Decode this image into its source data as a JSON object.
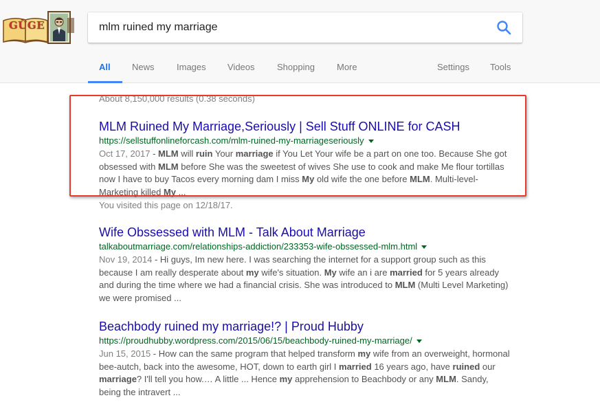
{
  "logo": {
    "text": "GŬGE",
    "icon": "doodle-book-portrait-icon"
  },
  "search": {
    "query": "mlm ruined my marriage",
    "icon": "search-icon"
  },
  "tabs": [
    {
      "label": "All",
      "active": true
    },
    {
      "label": "News"
    },
    {
      "label": "Images"
    },
    {
      "label": "Videos"
    },
    {
      "label": "Shopping"
    },
    {
      "label": "More"
    },
    {
      "label": "Settings"
    },
    {
      "label": "Tools"
    }
  ],
  "stats": "About 8,150,000 results (0.38 seconds)",
  "results": [
    {
      "title": "MLM Ruined My Marriage,Seriously | Sell Stuff ONLINE for CASH",
      "url": "https://sellstuffonlineforcash.com/mlm-ruined-my-marriageseriously",
      "date": "Oct 17, 2017",
      "snippet": [
        {
          "t": " - "
        },
        {
          "t": "MLM",
          "b": true
        },
        {
          "t": " will "
        },
        {
          "t": "ruin",
          "b": true
        },
        {
          "t": " Your "
        },
        {
          "t": "marriage",
          "b": true
        },
        {
          "t": " if You Let Your wife be a part on one too. Because She got obsessed with "
        },
        {
          "t": "MLM",
          "b": true
        },
        {
          "t": " before She was the sweetest of wives She use to cook and make Me flour tortillas now I have to buy Tacos every morning dam I miss "
        },
        {
          "t": "My",
          "b": true
        },
        {
          "t": " old wife the one before "
        },
        {
          "t": "MLM",
          "b": true
        },
        {
          "t": ". Multi-level-Marketing killed "
        },
        {
          "t": "My",
          "b": true
        },
        {
          "t": " ..."
        }
      ],
      "visited": "You visited this page on 12/18/17."
    },
    {
      "title": "Wife Obssessed with MLM - Talk About Marriage",
      "url": "talkaboutmarriage.com/relationships-addiction/233353-wife-obssessed-mlm.html",
      "date": "Nov 19, 2014",
      "snippet": [
        {
          "t": " - Hi guys, Im new here. I was searching the internet for a support group such as this because I am really desperate about "
        },
        {
          "t": "my",
          "b": true
        },
        {
          "t": " wife's situation. "
        },
        {
          "t": "My",
          "b": true
        },
        {
          "t": " wife an i are "
        },
        {
          "t": "married",
          "b": true
        },
        {
          "t": " for 5 years already and during the time where we had a financial crisis. She was introduced to "
        },
        {
          "t": "MLM",
          "b": true
        },
        {
          "t": " (Multi Level Marketing) we were promised ..."
        }
      ]
    },
    {
      "title": "Beachbody ruined my marriage!? | Proud Hubby",
      "url": "https://proudhubby.wordpress.com/2015/06/15/beachbody-ruined-my-marriage/",
      "date": "Jun 15, 2015",
      "snippet": [
        {
          "t": " - How can the same program that helped transform "
        },
        {
          "t": "my",
          "b": true
        },
        {
          "t": " wife from an overweight, hormonal bee-autch, back into the awesome, HOT, down to earth girl I "
        },
        {
          "t": "married",
          "b": true
        },
        {
          "t": " 16 years ago, have "
        },
        {
          "t": "ruined",
          "b": true
        },
        {
          "t": " our "
        },
        {
          "t": "marriage",
          "b": true
        },
        {
          "t": "? I'll tell you how.… A little ... Hence "
        },
        {
          "t": "my",
          "b": true
        },
        {
          "t": " apprehension to Beachbody or any "
        },
        {
          "t": "MLM",
          "b": true
        },
        {
          "t": ". Sandy, being the intravert ..."
        }
      ]
    }
  ],
  "colors": {
    "link": "#1a0dab",
    "url": "#006621",
    "snippet": "#545454",
    "tab_active": "#1a73e8",
    "highlight_box": "#e8392a"
  }
}
